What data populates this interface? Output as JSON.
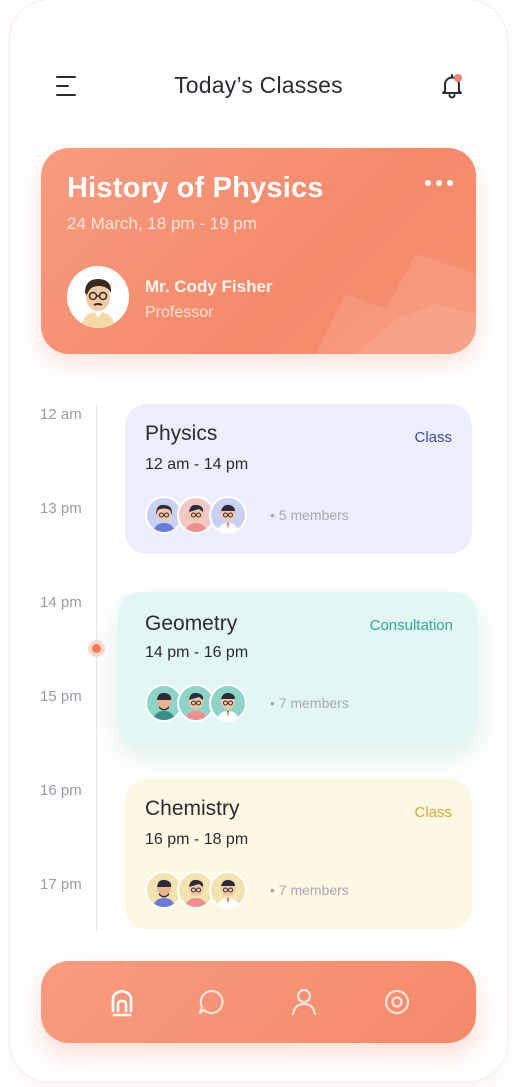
{
  "header": {
    "title": "Today’s Classes",
    "menu_icon": "hamburger-menu-icon",
    "notification_icon": "bell-icon"
  },
  "featured": {
    "title": "History of Physics",
    "date": "24 March, 18 pm - 19 pm",
    "teacher_name": "Mr. Cody Fisher",
    "teacher_role": "Professor",
    "more_icon": "more-dots-icon"
  },
  "timeline": {
    "labels": [
      "12 am",
      "13 pm",
      "14 pm",
      "15 pm",
      "16 pm",
      "17 pm"
    ]
  },
  "classes": [
    {
      "title": "Physics",
      "time": "12 am - 14 pm",
      "tag": "Class",
      "members": "• 5 members",
      "tag_color": "#3d4aa8",
      "bg_color": "#eceefc"
    },
    {
      "title": "Geometry",
      "time": "14 pm - 16 pm",
      "tag": "Consultation",
      "members": "• 7 members",
      "tag_color": "#2fa79a",
      "bg_color": "#e2f7f4"
    },
    {
      "title": "Chemistry",
      "time": "16 pm - 18 pm",
      "tag": "Class",
      "members": "• 7 members",
      "tag_color": "#d8a43a",
      "bg_color": "#fdf8e4"
    }
  ],
  "nav": {
    "items": [
      "home-icon",
      "chat-icon",
      "profile-icon",
      "target-icon"
    ],
    "accent": "#f58a6b"
  }
}
